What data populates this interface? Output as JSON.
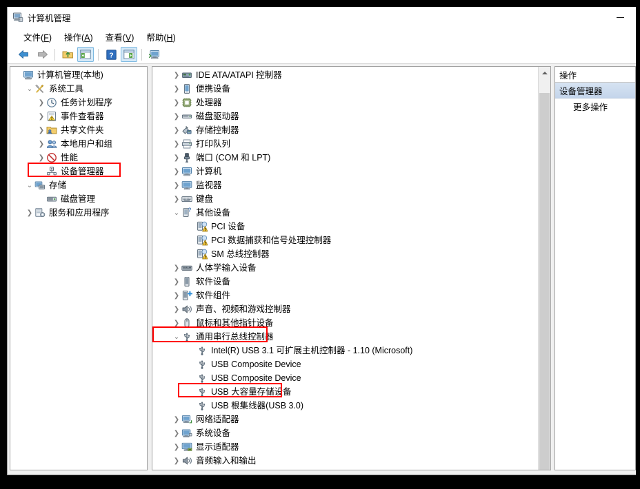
{
  "window": {
    "title": "计算机管理",
    "title_icon": "computer-management-icon",
    "minimize_label": "最小化"
  },
  "menubar": {
    "items": [
      {
        "name": "file",
        "label": "文件(F)",
        "text": "文件(",
        "key": "F",
        "tail": ")"
      },
      {
        "name": "action",
        "label": "操作(A)",
        "text": "操作(",
        "key": "A",
        "tail": ")"
      },
      {
        "name": "view",
        "label": "查看(V)",
        "text": "查看(",
        "key": "V",
        "tail": ")"
      },
      {
        "name": "help",
        "label": "帮助(H)",
        "text": "帮助(",
        "key": "H",
        "tail": ")"
      }
    ]
  },
  "toolbar": {
    "buttons": [
      {
        "name": "back-button",
        "icon": "back-arrow-icon",
        "pressed": false
      },
      {
        "name": "forward-button",
        "icon": "forward-arrow-icon",
        "pressed": false
      },
      {
        "name": "up-one-level-button",
        "icon": "folder-up-icon",
        "pressed": false
      },
      {
        "name": "show-console-tree-button",
        "icon": "console-tree-icon",
        "pressed": true
      },
      {
        "name": "help-button",
        "icon": "help-question-icon",
        "pressed": false
      },
      {
        "name": "show-action-pane-button",
        "icon": "action-pane-icon",
        "pressed": true
      },
      {
        "name": "scan-hardware-changes-button",
        "icon": "computer-scan-icon",
        "pressed": false
      }
    ]
  },
  "console_tree": {
    "items": [
      {
        "label": "计算机管理(本地)",
        "indent": 0,
        "twist": "none",
        "icon": "computer-icon",
        "selected": false,
        "highlight": false
      },
      {
        "label": "系统工具",
        "indent": 1,
        "twist": "expanded",
        "icon": "system-tools-icon",
        "selected": false,
        "highlight": false
      },
      {
        "label": "任务计划程序",
        "indent": 2,
        "twist": "collapsed",
        "icon": "clock-icon",
        "selected": false,
        "highlight": false
      },
      {
        "label": "事件查看器",
        "indent": 2,
        "twist": "collapsed",
        "icon": "event-viewer-icon",
        "selected": false,
        "highlight": false
      },
      {
        "label": "共享文件夹",
        "indent": 2,
        "twist": "collapsed",
        "icon": "shared-folder-icon",
        "selected": false,
        "highlight": false
      },
      {
        "label": "本地用户和组",
        "indent": 2,
        "twist": "collapsed",
        "icon": "users-groups-icon",
        "selected": false,
        "highlight": false
      },
      {
        "label": "性能",
        "indent": 2,
        "twist": "collapsed",
        "icon": "performance-icon",
        "selected": false,
        "highlight": false
      },
      {
        "label": "设备管理器",
        "indent": 2,
        "twist": "none",
        "icon": "device-manager-icon",
        "selected": false,
        "highlight": true
      },
      {
        "label": "存储",
        "indent": 1,
        "twist": "expanded",
        "icon": "storage-icon",
        "selected": false,
        "highlight": false
      },
      {
        "label": "磁盘管理",
        "indent": 2,
        "twist": "none",
        "icon": "disk-management-icon",
        "selected": false,
        "highlight": false
      },
      {
        "label": "服务和应用程序",
        "indent": 1,
        "twist": "collapsed",
        "icon": "services-apps-icon",
        "selected": false,
        "highlight": false
      }
    ]
  },
  "device_tree": {
    "items": [
      {
        "label": "IDE ATA/ATAPI 控制器",
        "indent": 1,
        "twist": "collapsed",
        "icon": "ide-controller-icon",
        "warn": false,
        "highlight": false
      },
      {
        "label": "便携设备",
        "indent": 1,
        "twist": "collapsed",
        "icon": "portable-device-icon",
        "warn": false,
        "highlight": false
      },
      {
        "label": "处理器",
        "indent": 1,
        "twist": "collapsed",
        "icon": "processor-icon",
        "warn": false,
        "highlight": false
      },
      {
        "label": "磁盘驱动器",
        "indent": 1,
        "twist": "collapsed",
        "icon": "disk-drive-icon",
        "warn": false,
        "highlight": false
      },
      {
        "label": "存储控制器",
        "indent": 1,
        "twist": "collapsed",
        "icon": "storage-controller-icon",
        "warn": false,
        "highlight": false
      },
      {
        "label": "打印队列",
        "indent": 1,
        "twist": "collapsed",
        "icon": "print-queue-icon",
        "warn": false,
        "highlight": false
      },
      {
        "label": "端口 (COM 和 LPT)",
        "indent": 1,
        "twist": "collapsed",
        "icon": "port-icon",
        "warn": false,
        "highlight": false
      },
      {
        "label": "计算机",
        "indent": 1,
        "twist": "collapsed",
        "icon": "computer-icon",
        "warn": false,
        "highlight": false
      },
      {
        "label": "监视器",
        "indent": 1,
        "twist": "collapsed",
        "icon": "monitor-icon",
        "warn": false,
        "highlight": false
      },
      {
        "label": "键盘",
        "indent": 1,
        "twist": "collapsed",
        "icon": "keyboard-icon",
        "warn": false,
        "highlight": false
      },
      {
        "label": "其他设备",
        "indent": 1,
        "twist": "expanded",
        "icon": "other-device-icon",
        "warn": false,
        "highlight": false
      },
      {
        "label": "PCI 设备",
        "indent": 2,
        "twist": "none",
        "icon": "unknown-device-icon",
        "warn": true,
        "highlight": false
      },
      {
        "label": "PCI 数据捕获和信号处理控制器",
        "indent": 2,
        "twist": "none",
        "icon": "unknown-device-icon",
        "warn": true,
        "highlight": false
      },
      {
        "label": "SM 总线控制器",
        "indent": 2,
        "twist": "none",
        "icon": "unknown-device-icon",
        "warn": true,
        "highlight": false
      },
      {
        "label": "人体学输入设备",
        "indent": 1,
        "twist": "collapsed",
        "icon": "hid-icon",
        "warn": false,
        "highlight": false
      },
      {
        "label": "软件设备",
        "indent": 1,
        "twist": "collapsed",
        "icon": "software-device-icon",
        "warn": false,
        "highlight": false
      },
      {
        "label": "软件组件",
        "indent": 1,
        "twist": "collapsed",
        "icon": "software-component-icon",
        "warn": false,
        "highlight": false
      },
      {
        "label": "声音、视频和游戏控制器",
        "indent": 1,
        "twist": "collapsed",
        "icon": "sound-video-game-icon",
        "warn": false,
        "highlight": false
      },
      {
        "label": "鼠标和其他指针设备",
        "indent": 1,
        "twist": "collapsed",
        "icon": "mouse-icon",
        "warn": false,
        "highlight": false
      },
      {
        "label": "通用串行总线控制器",
        "indent": 1,
        "twist": "expanded",
        "icon": "usb-icon",
        "warn": false,
        "highlight": true
      },
      {
        "label": "Intel(R) USB 3.1 可扩展主机控制器 - 1.10 (Microsoft)",
        "indent": 2,
        "twist": "none",
        "icon": "usb-icon",
        "warn": false,
        "highlight": false
      },
      {
        "label": "USB Composite Device",
        "indent": 2,
        "twist": "none",
        "icon": "usb-icon",
        "warn": false,
        "highlight": false
      },
      {
        "label": "USB Composite Device",
        "indent": 2,
        "twist": "none",
        "icon": "usb-icon",
        "warn": false,
        "highlight": false
      },
      {
        "label": "USB 大容量存储设备",
        "indent": 2,
        "twist": "none",
        "icon": "usb-icon",
        "warn": false,
        "highlight": true
      },
      {
        "label": "USB 根集线器(USB 3.0)",
        "indent": 2,
        "twist": "none",
        "icon": "usb-icon",
        "warn": false,
        "highlight": false
      },
      {
        "label": "网络适配器",
        "indent": 1,
        "twist": "collapsed",
        "icon": "network-adapter-icon",
        "warn": false,
        "highlight": false
      },
      {
        "label": "系统设备",
        "indent": 1,
        "twist": "collapsed",
        "icon": "system-device-icon",
        "warn": false,
        "highlight": false
      },
      {
        "label": "显示适配器",
        "indent": 1,
        "twist": "collapsed",
        "icon": "display-adapter-icon",
        "warn": false,
        "highlight": false
      },
      {
        "label": "音频输入和输出",
        "indent": 1,
        "twist": "collapsed",
        "icon": "audio-io-icon",
        "warn": false,
        "highlight": false
      }
    ]
  },
  "action_pane": {
    "header": "操作",
    "section": "设备管理器",
    "items": [
      {
        "label": "更多操作",
        "name": "more-actions-item"
      }
    ]
  },
  "colors": {
    "annotation_red": "#ff0000",
    "selection_blue": "#c4d5eb",
    "pressed_toolbar": "#d6eaf8",
    "window_bg": "#f0f0f0"
  }
}
